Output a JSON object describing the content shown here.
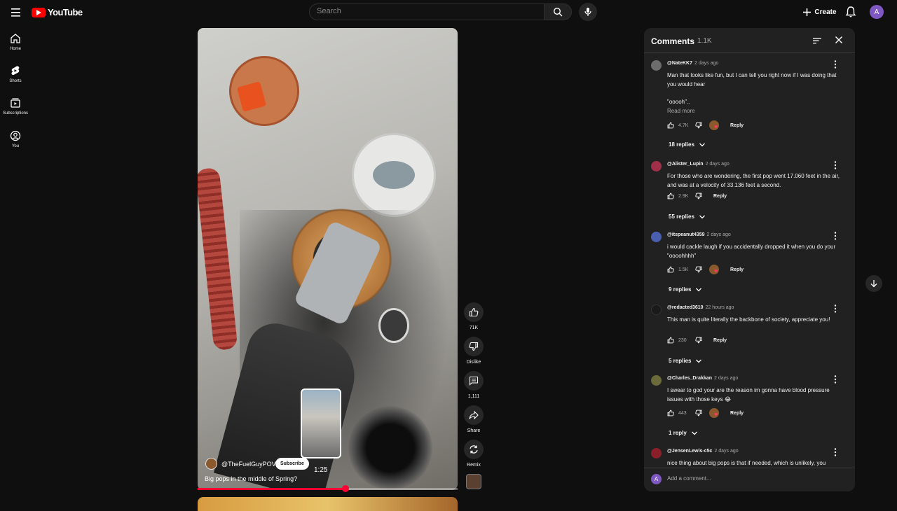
{
  "header": {
    "logo_text": "YouTube",
    "search_placeholder": "Search",
    "create_label": "Create",
    "avatar_letter": "A"
  },
  "nav": {
    "items": [
      {
        "label": "Home",
        "icon": "home-icon"
      },
      {
        "label": "Shorts",
        "icon": "shorts-icon"
      },
      {
        "label": "Subscriptions",
        "icon": "subscriptions-icon"
      },
      {
        "label": "You",
        "icon": "you-icon"
      }
    ]
  },
  "video": {
    "channel": "@TheFuelGuyPOV",
    "subscribe_label": "Subscribe",
    "title": "Big pops in the middle of Spring?",
    "preview_time": "1:25",
    "progress": 0.57
  },
  "actions": {
    "like_count": "71K",
    "dislike_label": "Dislike",
    "comment_count": "1,111",
    "share_label": "Share",
    "remix_label": "Remix"
  },
  "comments": {
    "title": "Comments",
    "count": "1.1K",
    "add_placeholder": "Add a comment...",
    "add_avatar_letter": "A",
    "read_more": "Read more",
    "reply_label": "Reply",
    "items": [
      {
        "user": "@NateKK7",
        "time": "2 days ago",
        "text": "Man that looks like fun, but I can tell you right now if I was doing that you would hear",
        "text2": "\"ooooh\"..",
        "likes": "4.7K",
        "creator_heart": true,
        "replies": "18 replies",
        "avatar_color": "#6d6d6d"
      },
      {
        "user": "@Alister_Lupin",
        "time": "2 days ago",
        "text": "For those who are wondering, the first pop went 17.060 feet in the air, and was at a velocity of 33.136 feet a second.",
        "likes": "2.9K",
        "creator_heart": false,
        "replies": "55 replies",
        "avatar_color": "#a0304a"
      },
      {
        "user": "@itspeanut4359",
        "time": "2 days ago",
        "text": "i would cackle laugh if you accidentally dropped it when you do your \"oooohhhh\"",
        "likes": "1.5K",
        "creator_heart": true,
        "replies": "9 replies",
        "avatar_color": "#4b5fb0"
      },
      {
        "user": "@redacted3610",
        "time": "22 hours ago",
        "text": "This man is quite literally the backbone of society, appreciate you!",
        "likes": "230",
        "creator_heart": false,
        "replies": "5 replies",
        "avatar_color": "#1a1a1a"
      },
      {
        "user": "@Charles_Drakkan",
        "time": "2 days ago",
        "text": "I swear to god your are the reason im gonna have blood pressure issues with those keys 😂",
        "likes": "443",
        "creator_heart": true,
        "replies": "1 reply",
        "avatar_color": "#6b6a3a"
      },
      {
        "user": "@JensenLewis-c5c",
        "time": "2 days ago",
        "text": "nice thing about big pops is that if needed, which is unlikely, you",
        "avatar_color": "#8a1f2a"
      }
    ]
  },
  "colors": {
    "background": "#0f0f0f",
    "panel": "#212121",
    "accent_red": "#ff0033"
  }
}
